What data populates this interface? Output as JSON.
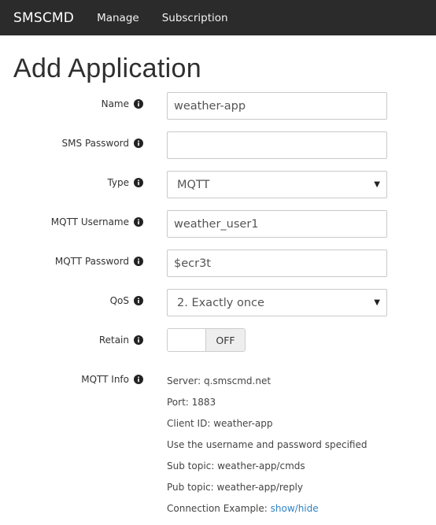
{
  "navbar": {
    "brand": "SMSCMD",
    "links": [
      "Manage",
      "Subscription"
    ]
  },
  "page": {
    "title": "Add Application"
  },
  "form": {
    "name": {
      "label": "Name",
      "value": "weather-app"
    },
    "sms_password": {
      "label": "SMS Password",
      "value": ""
    },
    "type": {
      "label": "Type",
      "selected": "MQTT"
    },
    "mqtt_username": {
      "label": "MQTT Username",
      "value": "weather_user1"
    },
    "mqtt_password": {
      "label": "MQTT Password",
      "value": "$ecr3t"
    },
    "qos": {
      "label": "QoS",
      "selected": "2. Exactly once"
    },
    "retain": {
      "label": "Retain",
      "state": "OFF"
    },
    "mqtt_info": {
      "label": "MQTT Info",
      "server": "Server: q.smscmd.net",
      "port": "Port: 1883",
      "client_id": "Client ID: weather-app",
      "credentials_note": "Use the username and password specified",
      "sub_topic": "Sub topic: weather-app/cmds",
      "pub_topic": "Pub topic: weather-app/reply",
      "connection_example_prefix": "Connection Example: ",
      "connection_example_link": "show/hide"
    }
  },
  "icons": {
    "info": "info-circle-icon",
    "caret": "caret-down-icon"
  },
  "colors": {
    "navbar": "#2b2b2b",
    "link": "#2e83c4"
  }
}
